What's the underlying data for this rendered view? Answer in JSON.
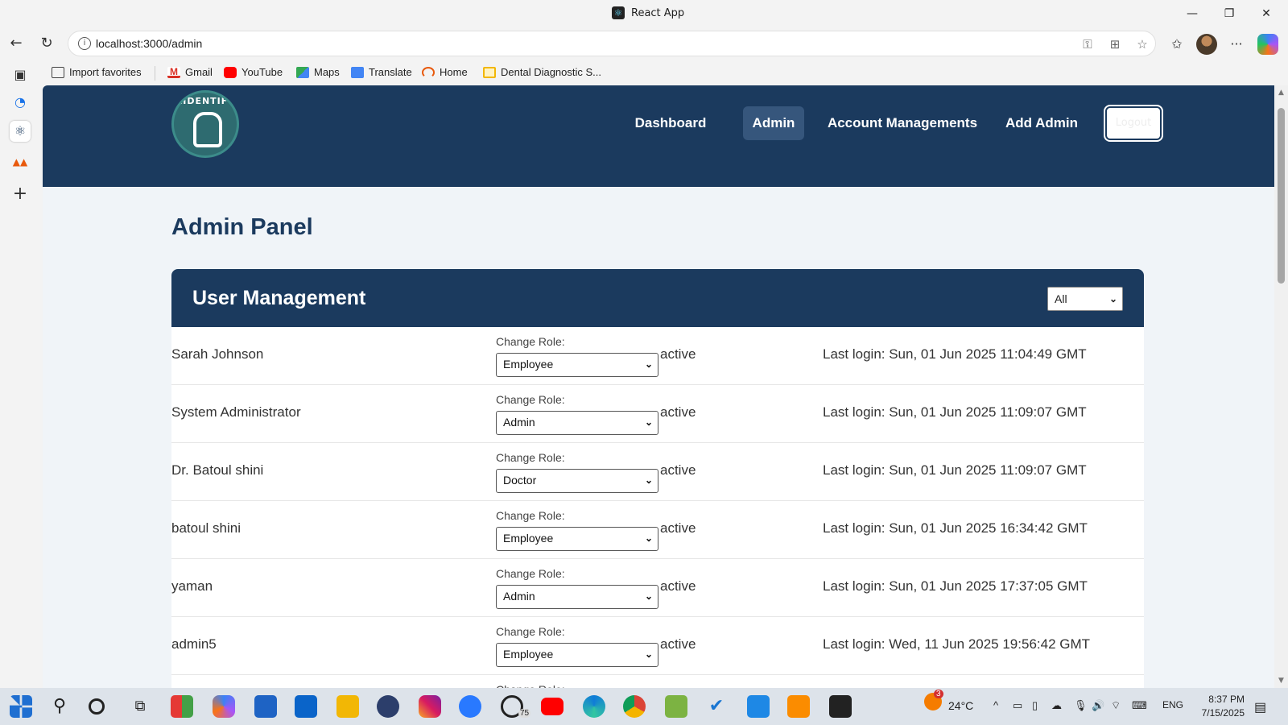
{
  "window": {
    "title": "React App"
  },
  "browser": {
    "url": "localhost:3000/admin",
    "favorites": [
      {
        "label": "Import favorites",
        "icon": "import-icon"
      },
      {
        "label": "Gmail",
        "icon": "gmail-icon"
      },
      {
        "label": "YouTube",
        "icon": "youtube-icon"
      },
      {
        "label": "Maps",
        "icon": "maps-icon"
      },
      {
        "label": "Translate",
        "icon": "translate-icon"
      },
      {
        "label": "Home",
        "icon": "home-icon"
      },
      {
        "label": "Dental Diagnostic S...",
        "icon": "folder-icon"
      }
    ]
  },
  "app": {
    "logo_text": "AIDENTIFY",
    "nav": [
      {
        "label": "Dashboard",
        "active": false
      },
      {
        "label": "Admin",
        "active": true
      },
      {
        "label": "Account Managements",
        "active": false
      },
      {
        "label": "Add Admin",
        "active": false
      }
    ],
    "logout_label": "Logout",
    "page_title": "Admin Panel",
    "card_title": "User Management",
    "filter_value": "All",
    "change_role_label": "Change Role:",
    "users": [
      {
        "name": "Sarah Johnson",
        "role": "Employee",
        "status": "active",
        "last_login": "Last login: Sun, 01 Jun 2025 11:04:49 GMT"
      },
      {
        "name": "System Administrator",
        "role": "Admin",
        "status": "active",
        "last_login": "Last login: Sun, 01 Jun 2025 11:09:07 GMT"
      },
      {
        "name": "Dr. Batoul shini",
        "role": "Doctor",
        "status": "active",
        "last_login": "Last login: Sun, 01 Jun 2025 11:09:07 GMT"
      },
      {
        "name": "batoul shini",
        "role": "Employee",
        "status": "active",
        "last_login": "Last login: Sun, 01 Jun 2025 16:34:42 GMT"
      },
      {
        "name": "yaman",
        "role": "Admin",
        "status": "active",
        "last_login": "Last login: Sun, 01 Jun 2025 17:37:05 GMT"
      },
      {
        "name": "admin5",
        "role": "Employee",
        "status": "active",
        "last_login": "Last login: Wed, 11 Jun 2025 19:56:42 GMT"
      }
    ]
  },
  "taskbar": {
    "weather": "24°C",
    "weather_badge": "3",
    "whatsapp_badge": "75",
    "language": "ENG",
    "time": "8:37 PM",
    "date": "7/15/2025"
  },
  "colors": {
    "header": "#1b3a5e",
    "page_bg": "#f0f4f8",
    "active_nav": "#36567c"
  }
}
